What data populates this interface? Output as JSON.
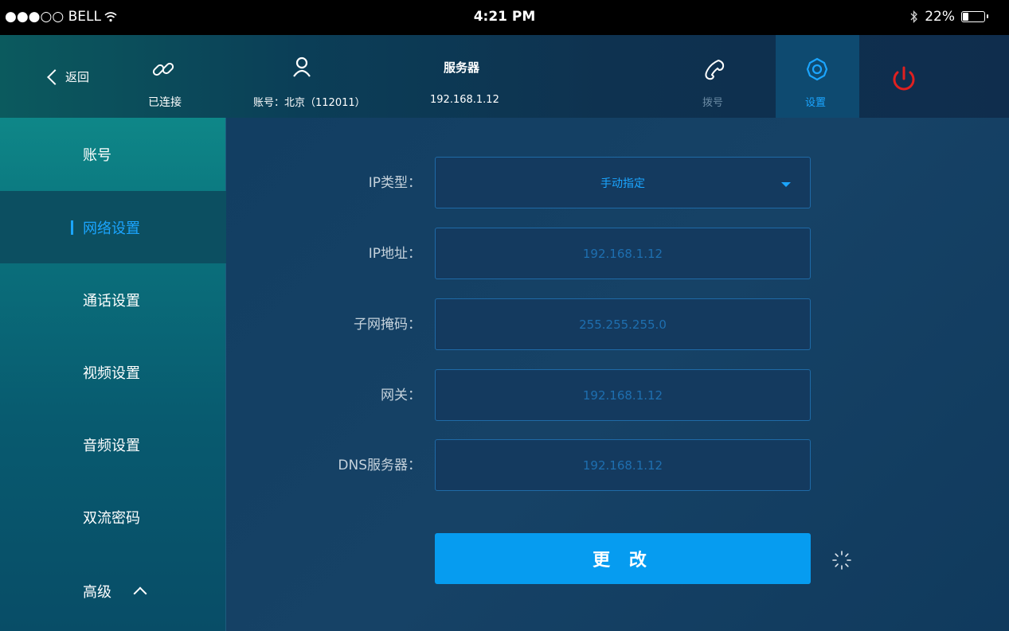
{
  "status_bar": {
    "carrier": "●●●○○ BELL",
    "time": "4:21 PM",
    "battery": "22%",
    "battery_level": 0.22
  },
  "topbar": {
    "back_label": "返回",
    "connection_label": "已连接",
    "account_text": "账号：北京（112011）",
    "server_title": "服务器",
    "server_ip": "192.168.1.12",
    "dial_label": "拨号",
    "settings_label": "设置"
  },
  "sidebar": {
    "items": [
      {
        "label": "账号",
        "active": false
      },
      {
        "label": "网络设置",
        "active": true
      },
      {
        "label": "通话设置",
        "active": false
      },
      {
        "label": "视频设置",
        "active": false
      },
      {
        "label": "音频设置",
        "active": false
      },
      {
        "label": "双流密码",
        "active": false
      },
      {
        "label": "高级",
        "active": false
      }
    ]
  },
  "form": {
    "ip_type_label": "IP类型：",
    "ip_type_value": "手动指定",
    "ip_address_label": "IP地址：",
    "ip_address_placeholder": "192.168.1.12",
    "subnet_label": "子网掩码：",
    "subnet_placeholder": "255.255.255.0",
    "gateway_label": "网关：",
    "gateway_placeholder": "192.168.1.12",
    "dns_label": "DNS服务器：",
    "dns_placeholder": "192.168.1.12",
    "submit_label": "更 改"
  },
  "colors": {
    "accent": "#1ba5ff",
    "button": "#069cf0",
    "power": "#e02020"
  }
}
